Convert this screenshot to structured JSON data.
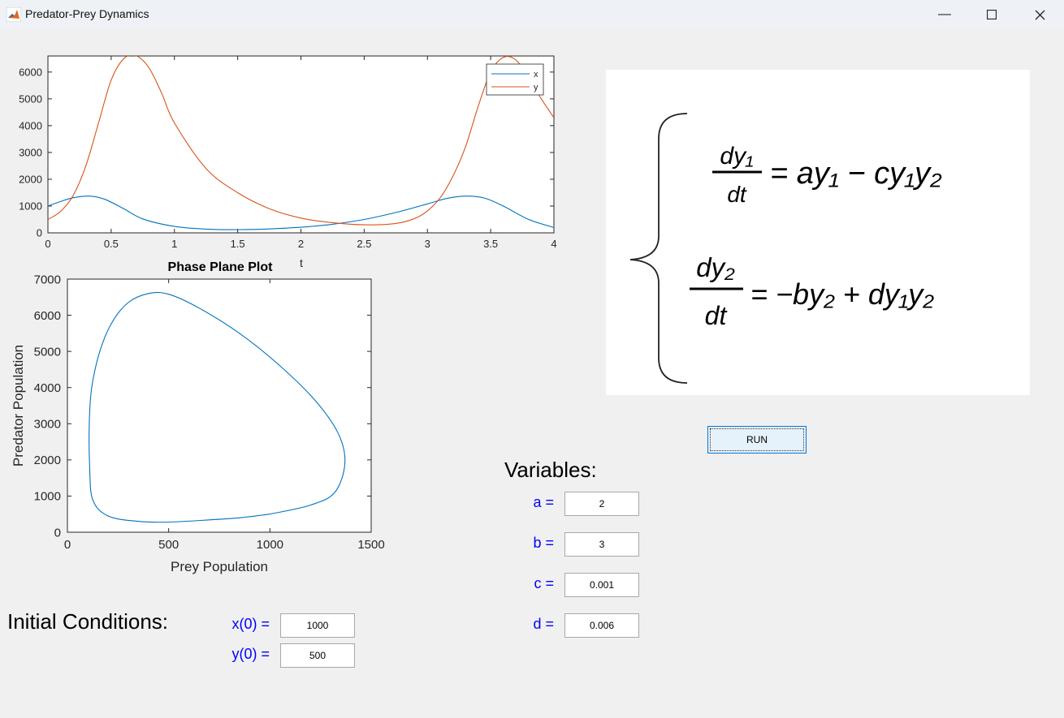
{
  "window": {
    "title": "Predator-Prey Dynamics"
  },
  "time_plot": {
    "xlabel": "t",
    "legend": [
      "x",
      "y"
    ]
  },
  "phase_plot": {
    "title": "Phase Plane Plot",
    "xlabel": "Prey Population",
    "ylabel": "Predator Population"
  },
  "chart_data": [
    {
      "type": "line",
      "xlabel": "t",
      "xlim": [
        0,
        4
      ],
      "ylim": [
        0,
        6600
      ],
      "xticks": [
        "0",
        "0.5",
        "1",
        "1.5",
        "2",
        "2.5",
        "3",
        "3.5",
        "4"
      ],
      "yticks": [
        "0",
        "1000",
        "2000",
        "3000",
        "4000",
        "5000",
        "6000"
      ],
      "legend_position": "top-right",
      "colors": [
        "#0072bd",
        "#d95319"
      ],
      "series": [
        {
          "name": "x",
          "x": [
            0,
            0.1,
            0.2,
            0.33,
            0.45,
            0.6,
            0.75,
            1.0,
            1.25,
            1.5,
            1.75,
            2.0,
            2.25,
            2.5,
            2.75,
            3.0,
            3.15,
            3.3,
            3.45,
            3.6,
            3.8,
            4.0
          ],
          "y": [
            1000,
            1170,
            1310,
            1370,
            1250,
            900,
            520,
            240,
            140,
            120,
            145,
            210,
            320,
            500,
            760,
            1080,
            1280,
            1370,
            1300,
            1000,
            500,
            200
          ]
        },
        {
          "name": "y",
          "x": [
            0,
            0.1,
            0.2,
            0.3,
            0.4,
            0.5,
            0.6,
            0.7,
            0.8,
            0.9,
            1.0,
            1.25,
            1.5,
            1.75,
            2.0,
            2.25,
            2.5,
            2.75,
            2.9,
            3.0,
            3.1,
            3.2,
            3.3,
            3.4,
            3.5,
            3.6,
            3.7,
            3.8,
            3.9,
            4.0
          ],
          "y": [
            500,
            800,
            1400,
            2500,
            4100,
            5700,
            6500,
            6600,
            6150,
            5200,
            4100,
            2400,
            1500,
            900,
            550,
            380,
            300,
            350,
            540,
            820,
            1300,
            2100,
            3200,
            4700,
            6000,
            6550,
            6450,
            5800,
            5000,
            4300
          ]
        }
      ]
    },
    {
      "type": "line",
      "title": "Phase Plane Plot",
      "xlabel": "Prey Population",
      "ylabel": "Predator Population",
      "xlim": [
        0,
        1500
      ],
      "ylim": [
        0,
        7000
      ],
      "xticks": [
        "0",
        "500",
        "1000",
        "1500"
      ],
      "yticks": [
        "0",
        "1000",
        "2000",
        "3000",
        "4000",
        "5000",
        "6000",
        "7000"
      ],
      "colors": [
        "#0072bd"
      ],
      "series": [
        {
          "x": [
            1000,
            1200,
            1320,
            1370,
            1340,
            1230,
            1050,
            850,
            650,
            500,
            400,
            300,
            220,
            160,
            120,
            108,
            110,
            125,
            200,
            350,
            500,
            700,
            850,
            1000
          ],
          "y": [
            500,
            750,
            1100,
            1900,
            2700,
            3600,
            4600,
            5500,
            6200,
            6580,
            6600,
            6350,
            5800,
            5000,
            4000,
            3000,
            1800,
            900,
            450,
            300,
            280,
            340,
            400,
            500
          ]
        }
      ]
    }
  ],
  "equations": {
    "eq1": {
      "num": "dy₁",
      "den": "dt",
      "rhs": "= ay₁ − cy₁y₂"
    },
    "eq2": {
      "num": "dy₂",
      "den": "dt",
      "rhs": "= −by₂ + dy₁y₂"
    }
  },
  "run_button": "RUN",
  "variables": {
    "heading": "Variables:",
    "a_label": "a =",
    "a_value": "2",
    "b_label": "b =",
    "b_value": "3",
    "c_label": "c =",
    "c_value": "0.001",
    "d_label": "d =",
    "d_value": "0.006"
  },
  "initial_conditions": {
    "heading": "Initial Conditions:",
    "x0_label": "x(0) =",
    "x0_value": "1000",
    "y0_label": "y(0) =",
    "y0_value": "500"
  }
}
